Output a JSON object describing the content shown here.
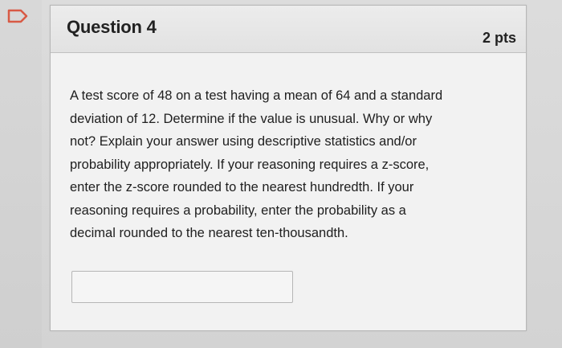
{
  "question": {
    "title": "Question 4",
    "points": "2 pts",
    "body_lines": [
      "A test score of 48 on a test having a mean of 64 and a standard",
      "deviation of 12. Determine if the value is unusual. Why or why",
      "not? Explain your answer using descriptive statistics and/or",
      "probability appropriately. If your reasoning requires a z-score,",
      "enter the z-score rounded to the nearest hundredth. If your",
      "reasoning requires a probability, enter the probability as a",
      "decimal rounded to the nearest ten-thousandth."
    ],
    "answer_value": ""
  },
  "icons": {
    "flag": "flag-icon"
  },
  "colors": {
    "flag_outline": "#d85a45",
    "card_background": "#f2f2f2",
    "header_background": "#e4e4e4"
  }
}
